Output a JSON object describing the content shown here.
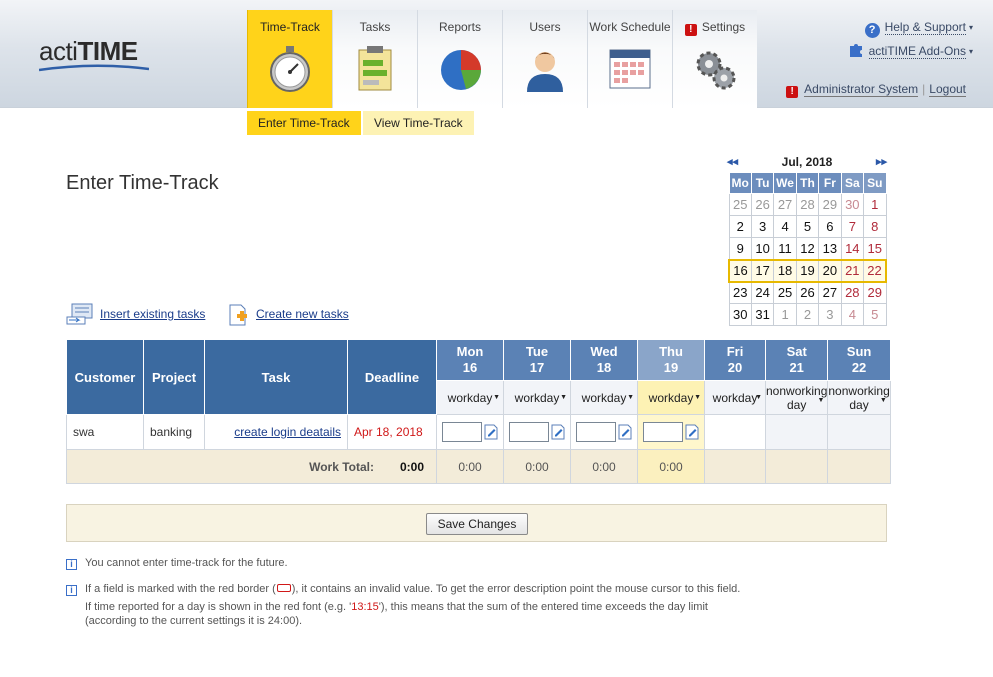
{
  "app": {
    "logo_text_a": "acti",
    "logo_text_b": "TIME"
  },
  "nav": {
    "tabs": [
      {
        "label": "Time-Track",
        "icon": "stopwatch-icon",
        "active": true
      },
      {
        "label": "Tasks",
        "icon": "clipboard-icon"
      },
      {
        "label": "Reports",
        "icon": "pie-chart-icon"
      },
      {
        "label": "Users",
        "icon": "user-icon"
      },
      {
        "label": "Work Schedule",
        "icon": "calendar-icon"
      },
      {
        "label": "Settings",
        "icon": "gears-icon"
      }
    ],
    "settings_warning": "!",
    "subtabs": [
      {
        "label": "Enter Time-Track",
        "active": true
      },
      {
        "label": "View Time-Track"
      }
    ]
  },
  "topright": {
    "help_label": "Help & Support",
    "addons_label": "actiTIME Add-Ons",
    "help_icon_glyph": "?",
    "caret": "▾",
    "user_name": "Administrator System",
    "separator": "|",
    "logout_label": "Logout"
  },
  "page": {
    "title": "Enter Time-Track"
  },
  "calendar": {
    "month_label": "Jul, 2018",
    "prev": "◂◂",
    "next": "▸▸",
    "weekdays": [
      "Mo",
      "Tu",
      "We",
      "Th",
      "Fr",
      "Sa",
      "Su"
    ],
    "weeks": [
      [
        "25",
        "26",
        "27",
        "28",
        "29",
        "30",
        "1"
      ],
      [
        "2",
        "3",
        "4",
        "5",
        "6",
        "7",
        "8"
      ],
      [
        "9",
        "10",
        "11",
        "12",
        "13",
        "14",
        "15"
      ],
      [
        "16",
        "17",
        "18",
        "19",
        "20",
        "21",
        "22"
      ],
      [
        "23",
        "24",
        "25",
        "26",
        "27",
        "28",
        "29"
      ],
      [
        "30",
        "31",
        "1",
        "2",
        "3",
        "4",
        "5"
      ]
    ],
    "current_week_index": 3
  },
  "actions": {
    "insert_tasks": "Insert existing tasks",
    "create_tasks": "Create new tasks"
  },
  "grid": {
    "headers": {
      "customer": "Customer",
      "project": "Project",
      "task": "Task",
      "deadline": "Deadline"
    },
    "days": [
      {
        "name": "Mon",
        "date": "16",
        "type": "workday"
      },
      {
        "name": "Tue",
        "date": "17",
        "type": "workday"
      },
      {
        "name": "Wed",
        "date": "18",
        "type": "workday"
      },
      {
        "name": "Thu",
        "date": "19",
        "type": "workday",
        "today": true
      },
      {
        "name": "Fri",
        "date": "20",
        "type": "workday"
      },
      {
        "name": "Sat",
        "date": "21",
        "type": "nonworking day"
      },
      {
        "name": "Sun",
        "date": "22",
        "type": "nonworking day"
      }
    ],
    "rows": [
      {
        "customer": "swa",
        "project": "banking",
        "task": "create login deatails",
        "deadline": "Apr 18, 2018"
      }
    ],
    "total_label": "Work Total:",
    "total_value": "0:00",
    "day_totals": [
      "0:00",
      "0:00",
      "0:00",
      "0:00"
    ]
  },
  "save_label": "Save Changes",
  "info": {
    "line1": "You cannot enter time-track for the future.",
    "line2a": "If a field is marked with the red border (",
    "line2b": "), it contains an invalid value. To get the error description point the mouse cursor to this field.",
    "line3a": "If time reported for a day is shown in the red font (e.g. '",
    "line3_example": "13:15",
    "line3b": "'), this means that the sum of the entered time exceeds the day limit",
    "line4": "(according to the current settings it is 24:00)."
  },
  "colors": {
    "accent_yellow": "#ffd31a",
    "header_blue": "#3b6aa0",
    "link_blue": "#1a3c8a",
    "error_red": "#d01818"
  }
}
